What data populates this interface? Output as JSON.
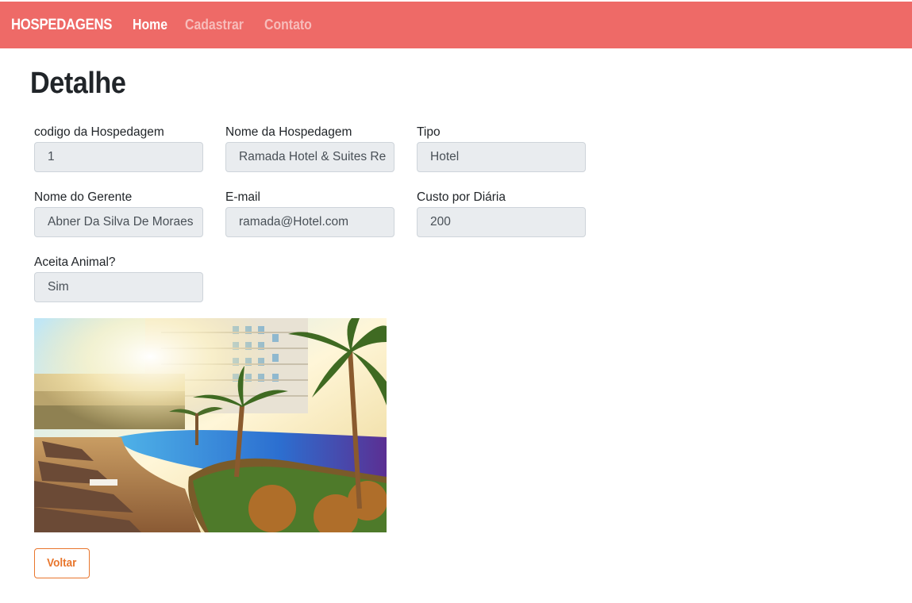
{
  "navbar": {
    "brand": "HOSPEDAGENS",
    "links": [
      {
        "label": "Home",
        "active": true
      },
      {
        "label": "Cadastrar",
        "active": false
      },
      {
        "label": "Contato",
        "active": false
      }
    ],
    "color": "#ee6a67"
  },
  "page": {
    "title": "Detalhe"
  },
  "form": {
    "codigo": {
      "label": "codigo da Hospedagem",
      "value": "1"
    },
    "nome": {
      "label": "Nome da Hospedagem",
      "value": "Ramada Hotel & Suites Re"
    },
    "tipo": {
      "label": "Tipo",
      "value": "Hotel"
    },
    "gerente": {
      "label": "Nome do Gerente",
      "value": "Abner Da Silva De Moraes"
    },
    "email": {
      "label": "E-mail",
      "value": "ramada@Hotel.com"
    },
    "custo": {
      "label": "Custo por Diária",
      "value": "200"
    },
    "animal": {
      "label": "Aceita Animal?",
      "value": "Sim"
    }
  },
  "photo": {
    "subject": "hotel pool with palm trees and loungers"
  },
  "actions": {
    "back_label": "Voltar",
    "accent": "#e8762d"
  }
}
